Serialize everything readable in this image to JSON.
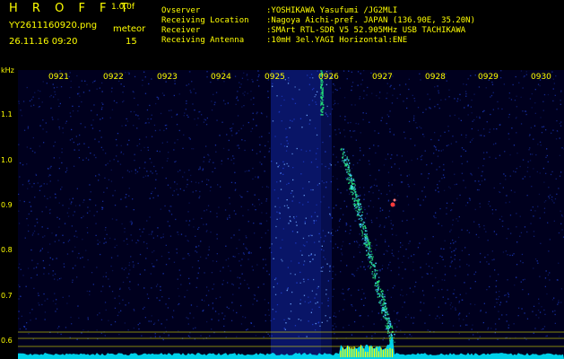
{
  "header": {
    "title": "H R O F F T",
    "version": "1.0.0f",
    "file_name": "YY2611160920.png",
    "mode": "meteor",
    "timestamp": "26.11.16 09:20",
    "count": "15"
  },
  "info": [
    {
      "label": "Ovserver",
      "value": ":YOSHIKAWA Yasufumi /JG2MLI"
    },
    {
      "label": "Receiving Location",
      "value": ":Nagoya Aichi-pref. JAPAN (136.90E, 35.20N)"
    },
    {
      "label": "Receiver",
      "value": ":SMArt RTL-SDR V5 52.905MHz USB TACHIKAWA"
    },
    {
      "label": "Receiving Antenna",
      "value": ":10mH 3el.YAGI Horizontal:ENE"
    }
  ],
  "chart_data": {
    "type": "heatmap",
    "ylabel": "kHz",
    "y_ticks": [
      "1.1",
      "1.0",
      "0.9",
      "0.8",
      "0.7",
      "0.6"
    ],
    "x_ticks": [
      "0921",
      "0922",
      "0923",
      "0924",
      "0925",
      "0926",
      "0927",
      "0928",
      "0929",
      "0930"
    ],
    "colors": {
      "background": "#00001e",
      "noise": "#1f3fd0",
      "signal": "#24e07a",
      "baseline": "#00e8ff",
      "grid": "#ffff00"
    }
  }
}
